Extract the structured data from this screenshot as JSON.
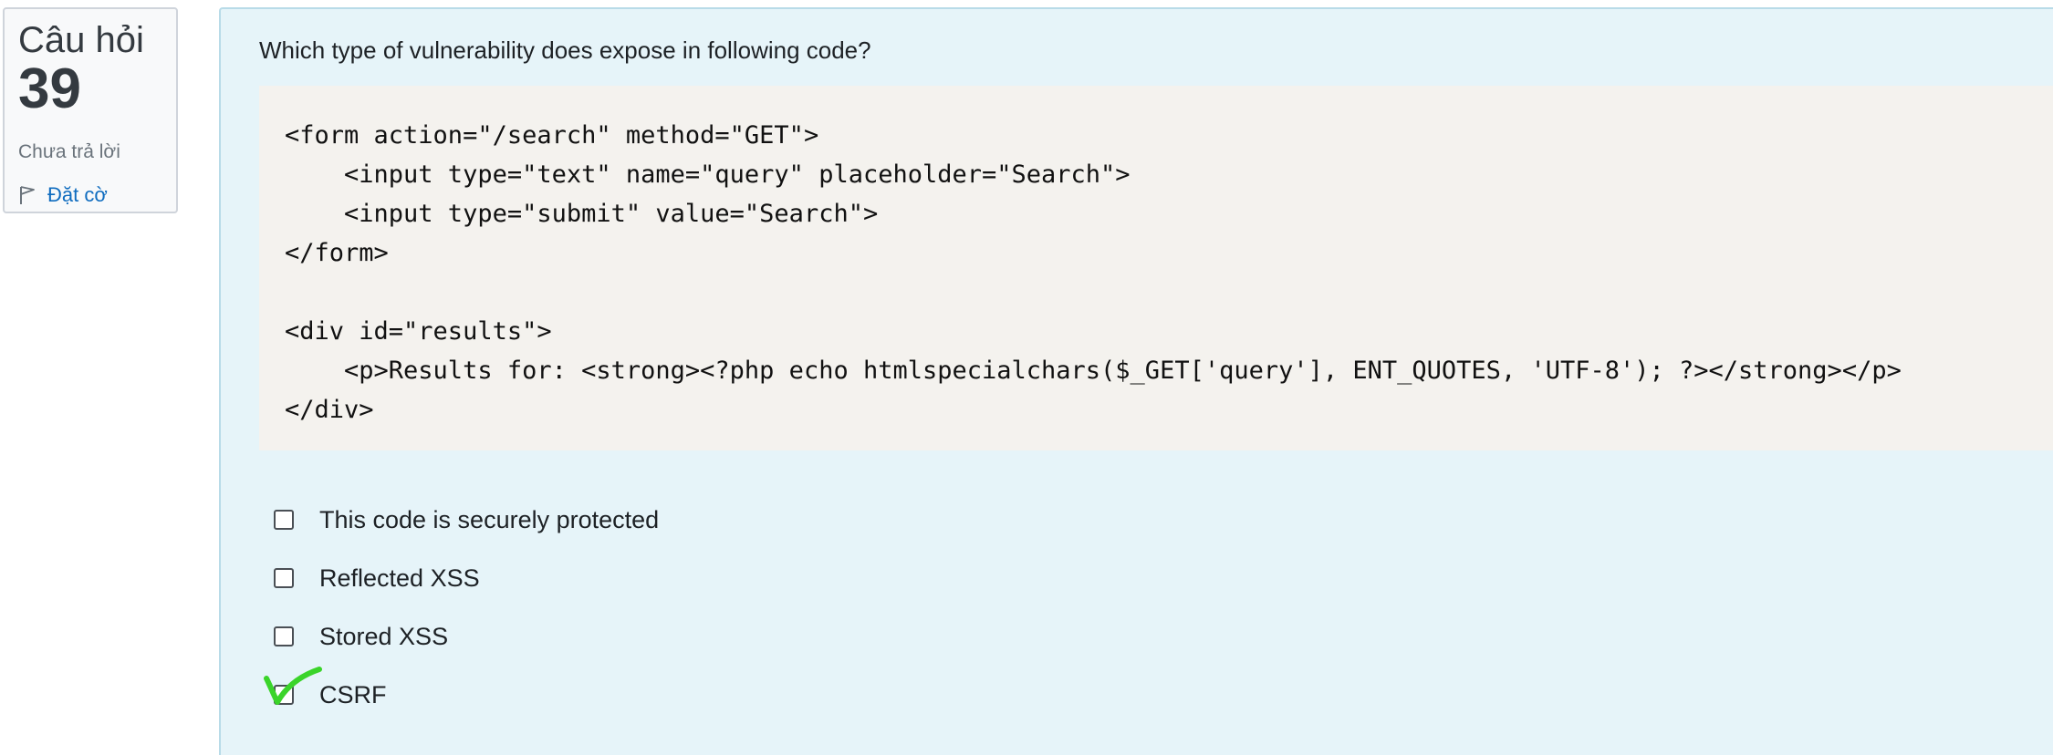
{
  "info": {
    "label": "Câu hỏi",
    "number": "39",
    "state": "Chưa trả lời",
    "flag_label": "Đặt cờ"
  },
  "question": {
    "text": "Which type of vulnerability does expose in following code?",
    "code_lines": [
      "<form action=\"/search\" method=\"GET\">",
      "    <input type=\"text\" name=\"query\" placeholder=\"Search\">",
      "    <input type=\"submit\" value=\"Search\">",
      "</form>",
      "",
      "<div id=\"results\">",
      "    <p>Results for: <strong><?php echo htmlspecialchars($_GET['query'], ENT_QUOTES, 'UTF-8'); ?></strong></p>",
      "</div>"
    ]
  },
  "answers": [
    {
      "label": "This code is securely protected",
      "checked": false
    },
    {
      "label": "Reflected XSS",
      "checked": false
    },
    {
      "label": "Stored XSS",
      "checked": false
    },
    {
      "label": "CSRF",
      "checked": false
    }
  ],
  "colors": {
    "accent": "#0f6cbf",
    "content_bg": "#e6f4f9",
    "code_bg": "#f4f2ee",
    "handwritten_check": "#3ad42a"
  }
}
